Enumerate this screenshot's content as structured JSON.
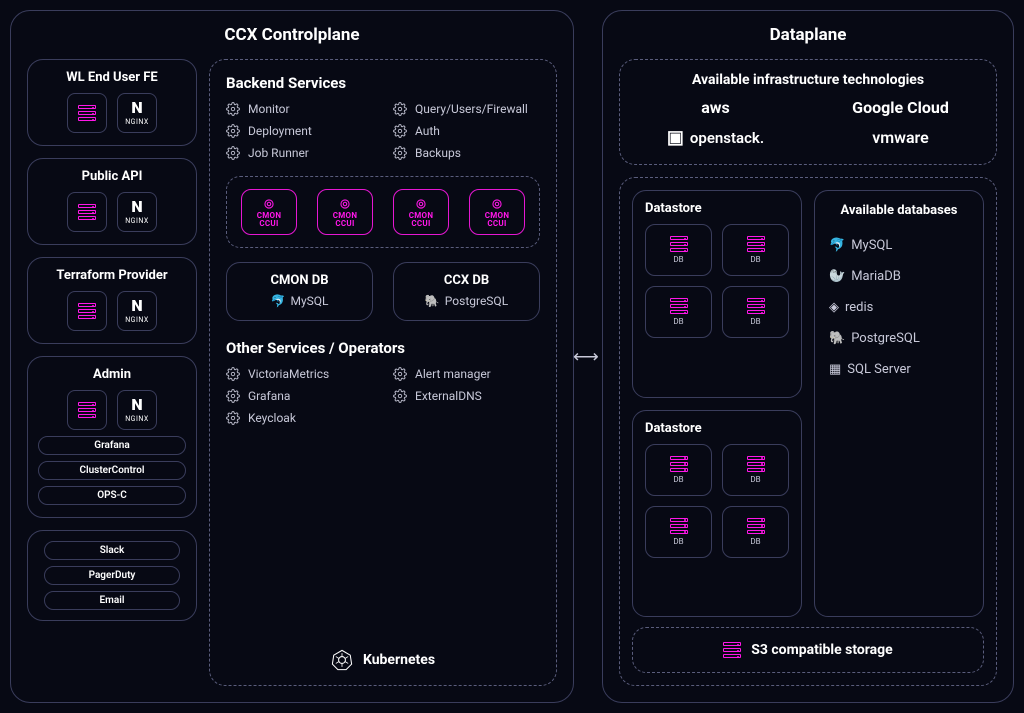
{
  "controlplane": {
    "title": "CCX Controlplane",
    "left": {
      "wl": {
        "title": "WL End User FE",
        "nginx": "NGINX"
      },
      "api": {
        "title": "Public API",
        "nginx": "NGINX"
      },
      "tf": {
        "title": "Terraform Provider",
        "nginx": "NGINX"
      },
      "admin": {
        "title": "Admin",
        "nginx": "NGINX",
        "tools": [
          "Grafana",
          "ClusterControl",
          "OPS-C"
        ]
      },
      "alerts": [
        "Slack",
        "PagerDuty",
        "Email"
      ]
    },
    "backend": {
      "title": "Backend Services",
      "services_left": [
        "Monitor",
        "Deployment",
        "Job Runner"
      ],
      "services_right": [
        "Query/Users/Firewall",
        "Auth",
        "Backups"
      ],
      "cmon_label": "CMON\nCCUI",
      "cmon_count": 4,
      "cmon_db": {
        "title": "CMON DB",
        "logo": "MySQL"
      },
      "ccx_db": {
        "title": "CCX DB",
        "logo": "PostgreSQL"
      }
    },
    "other": {
      "title": "Other Services / Operators",
      "left": [
        "VictoriaMetrics",
        "Grafana",
        "Keycloak"
      ],
      "right": [
        "Alert manager",
        "ExternalDNS"
      ]
    },
    "k8s": "Kubernetes"
  },
  "dataplane": {
    "title": "Dataplane",
    "infra": {
      "title": "Available infrastructure technologies",
      "logos": [
        "aws",
        "Google Cloud",
        "openstack.",
        "vmware"
      ]
    },
    "datastores": {
      "title": "Datastore",
      "db_label": "DB"
    },
    "avail_db": {
      "title": "Available databases",
      "items": [
        "MySQL",
        "MariaDB",
        "redis",
        "PostgreSQL",
        "SQL Server"
      ]
    },
    "s3": "S3 compatible storage"
  }
}
